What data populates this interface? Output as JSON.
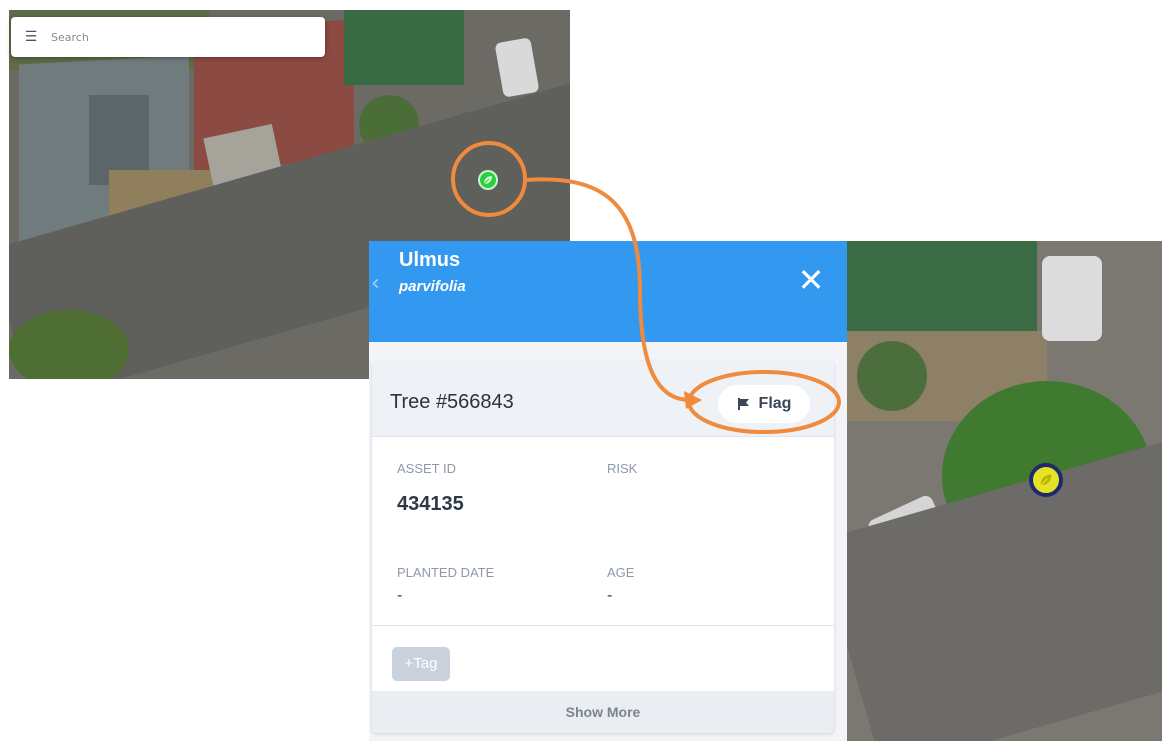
{
  "search": {
    "placeholder": "Search"
  },
  "panel": {
    "genus": "Ulmus",
    "species": "parvifolia",
    "tree_title": "Tree #566843",
    "flag_label": "Flag",
    "fields": {
      "asset_id_label": "ASSET ID",
      "asset_id_value": "434135",
      "risk_label": "RISK",
      "planted_label": "PLANTED DATE",
      "planted_value": "-",
      "age_label": "AGE",
      "age_value": "-"
    },
    "tag_label": "+Tag",
    "show_more_label": "Show More"
  },
  "colors": {
    "header_blue": "#3399f0",
    "annotation_orange": "#f08a3c",
    "marker_green": "#2ecc40",
    "marker_yellow": "#e7e227",
    "marker_ring": "#1d2a6e"
  },
  "icons": [
    "menu-icon",
    "leaf-icon",
    "back-chevron-icon",
    "close-icon",
    "flag-icon"
  ]
}
